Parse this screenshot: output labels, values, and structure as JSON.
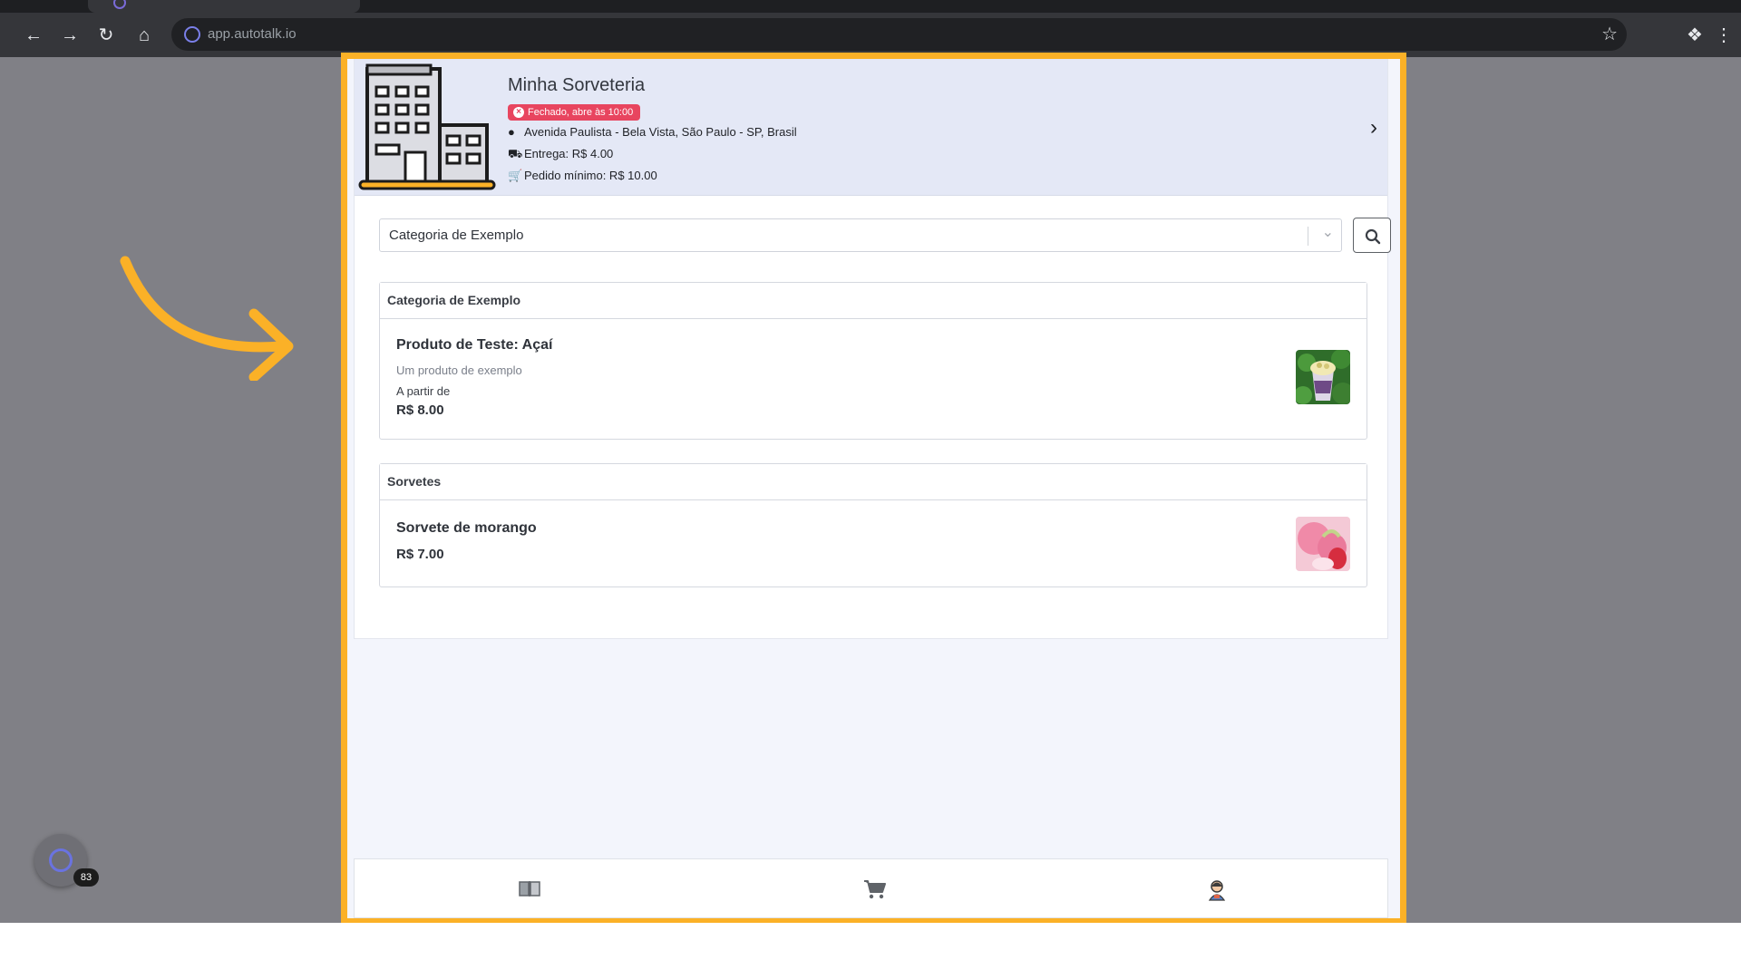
{
  "browser": {
    "url": "app.autotalk.io"
  },
  "extension": {
    "badge_count": "83"
  },
  "store": {
    "name": "Minha Sorveteria",
    "status": "Fechado, abre às 10:00",
    "address": "Avenida Paulista - Bela Vista, São Paulo - SP, Brasil",
    "delivery": "Entrega: R$ 4.00",
    "min_order": "Pedido mínimo: R$ 10.00"
  },
  "category_select": {
    "value": "Categoria de Exemplo"
  },
  "categories": [
    {
      "title": "Categoria de Exemplo",
      "product": {
        "name": "Produto de Teste: Açaí",
        "description": "Um produto de exemplo",
        "from_label": "A partir de",
        "price": "R$ 8.00"
      }
    },
    {
      "title": "Sorvetes",
      "product": {
        "name": "Sorvete de morango",
        "price": "R$ 7.00"
      }
    }
  ],
  "colors": {
    "highlight_border": "#fbb127",
    "status_closed": "#e8455f",
    "header_bg": "#e4e8f6"
  },
  "icons": {
    "nav_menu": "book-icon",
    "nav_cart": "cart-icon",
    "nav_profile": "user-icon"
  }
}
